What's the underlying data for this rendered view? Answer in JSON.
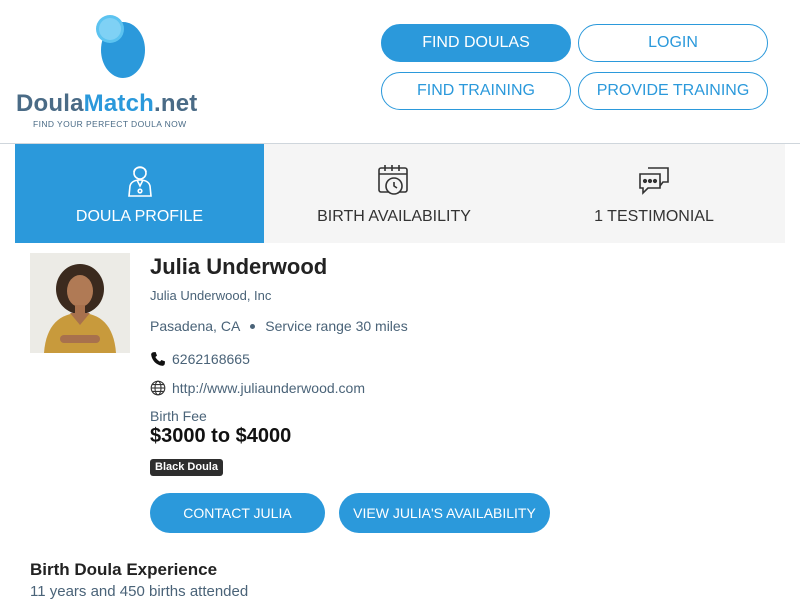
{
  "brand": {
    "name_part1": "Doula",
    "name_part2": "Match",
    "name_part3": ".net",
    "tagline": "FIND YOUR PERFECT DOULA NOW",
    "colors": {
      "accent": "#2b99db",
      "text_slate": "#4a6b86",
      "light_blue": "#5cc3f0"
    }
  },
  "nav": {
    "find_doulas": "FIND DOULAS",
    "login": "LOGIN",
    "find_training": "FIND TRAINING",
    "provide_training": "PROVIDE TRAINING"
  },
  "tabs": [
    {
      "label": "DOULA PROFILE",
      "icon": "person-icon",
      "active": true
    },
    {
      "label": "BIRTH AVAILABILITY",
      "icon": "calendar-clock-icon",
      "active": false
    },
    {
      "label": "1 TESTIMONIAL",
      "icon": "chat-bubbles-icon",
      "active": false
    }
  ],
  "profile": {
    "name": "Julia Underwood",
    "company": "Julia Underwood, Inc",
    "location": "Pasadena, CA",
    "service_range": "Service range 30 miles",
    "phone": "6262168665",
    "website": "http://www.juliaunderwood.com",
    "fee_label": "Birth Fee",
    "fee_value": "$3000 to $4000",
    "badge": "Black Doula",
    "contact_button": "CONTACT JULIA",
    "availability_button": "VIEW JULIA'S AVAILABILITY"
  },
  "experience": {
    "title": "Birth Doula Experience",
    "text": "11 years and 450 births attended"
  }
}
